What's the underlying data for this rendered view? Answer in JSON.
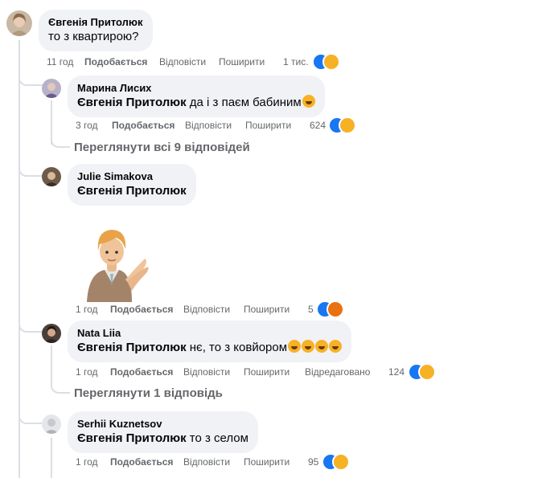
{
  "comment": {
    "author": "Євгенія Притолюк",
    "text": "то з квартирою?",
    "time": "11 год",
    "like_label": "Подобається",
    "reply_label": "Відповісти",
    "share_label": "Поширити",
    "reactions_count": "1 тис."
  },
  "replies": [
    {
      "author": "Марина Лисих",
      "mention": "Євгенія Притолюк",
      "text": "да і з паєм бабиним",
      "time": "3 год",
      "like_label": "Подобається",
      "reply_label": "Відповісти",
      "share_label": "Поширити",
      "reactions_count": "624"
    },
    {
      "author": "Julie Simakova",
      "mention": "Євгенія Притолюк",
      "text": "",
      "time": "1 год",
      "like_label": "Подобається",
      "reply_label": "Відповісти",
      "share_label": "Поширити",
      "reactions_count": "5"
    },
    {
      "author": "Nata Liia",
      "mention": "Євгенія Притолюк",
      "text": "нє, то з ковйором",
      "time": "1 год",
      "like_label": "Подобається",
      "reply_label": "Відповісти",
      "share_label": "Поширити",
      "edited_label": "Відредаговано",
      "reactions_count": "124"
    },
    {
      "author": "Serhii Kuznetsov",
      "mention": "Євгенія Притолюк",
      "text": "то з селом",
      "time": "1 год",
      "like_label": "Подобається",
      "reply_label": "Відповісти",
      "share_label": "Поширити",
      "reactions_count": "95"
    }
  ],
  "view_more": [
    "Переглянути всі 9 відповідей",
    "Переглянути 1 відповідь"
  ],
  "colors": {
    "bubble": "#f0f2f5",
    "meta": "#65676b",
    "thread": "#dcdee3",
    "like": "#1877f2",
    "haha": "#f7b125",
    "angry": "#e9710f"
  }
}
